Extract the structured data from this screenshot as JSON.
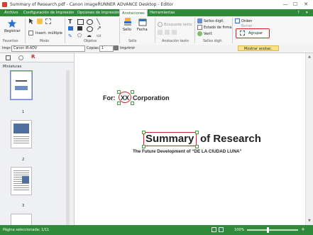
{
  "window": {
    "title": "Summary of Research.pdf - Canon imageRUNNER ADVANCE Desktop - Editor",
    "minimize": "—",
    "maximize": "☐",
    "close": "✕"
  },
  "menu": {
    "items": [
      "Archivo",
      "Configuración de impresión",
      "Opciones de impresión",
      "Anotaciones",
      "Herramientas"
    ],
    "active_index": 3,
    "right_icons": [
      "?",
      "▾"
    ]
  },
  "ribbon": {
    "register_label": "Registrar",
    "insert_label": "Insert. múltiple",
    "groups": [
      "Favoritos",
      "Modo",
      "Objetos",
      "Sello",
      "Anotación texto",
      "Sellos digit."
    ],
    "stamp_label": "Sello",
    "date_label": "Fecha",
    "search_text": "Búsqueda texto",
    "digital_stamps": "Sellos digit.",
    "signature_status": "Estado de firma",
    "verify": "Verif.",
    "order_label": "Orden",
    "delete_label": "Borrar",
    "group_label": "Agrupar"
  },
  "toolbar2": {
    "printer_label": "Impr:",
    "printer_value": "Canon iR-ADV",
    "copies_label": "Copias:",
    "copies_value": "1",
    "print_label": "Imprimir",
    "show_annotations": "Mostrar anotac."
  },
  "sidebar": {
    "title": "Miniaturas",
    "pages": [
      "1",
      "2",
      "3"
    ]
  },
  "document": {
    "for_prefix": "For:",
    "company_code": "XX",
    "company_suffix": "Corporation",
    "heading_word": "Summary",
    "heading_rest": "of Research",
    "subtitle": "The Future Development of “DE LA CIUDAD LUNA”"
  },
  "status": {
    "pages_selected": "Página seleccionada: 1/11",
    "zoom": "100%"
  }
}
